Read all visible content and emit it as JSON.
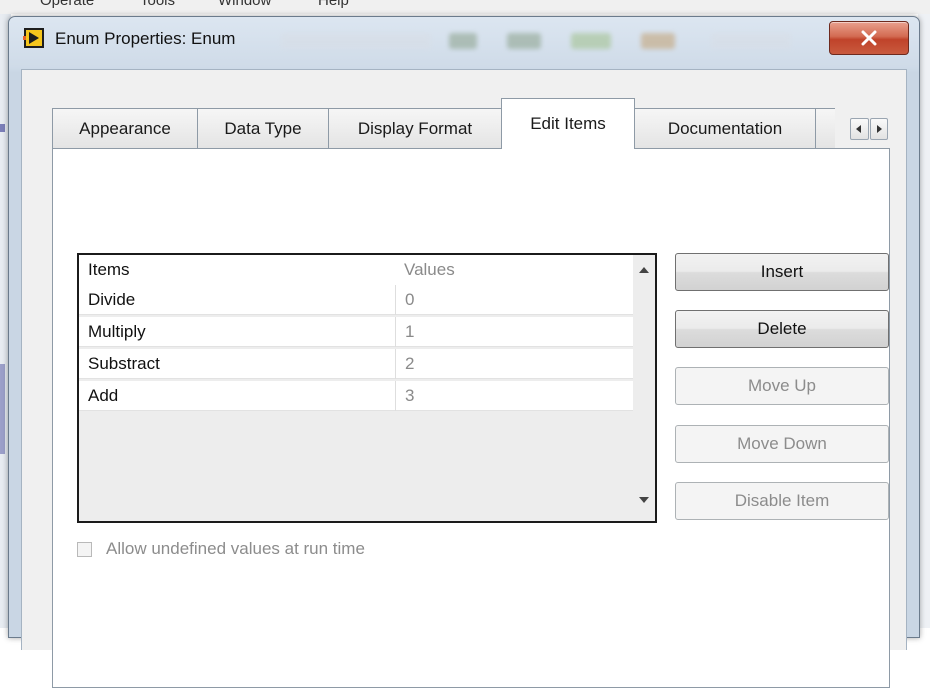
{
  "background_app": {
    "menu_items": [
      "Operate",
      "Tools",
      "Window",
      "Help"
    ]
  },
  "dialog": {
    "title": "Enum Properties: Enum",
    "tabs": [
      {
        "label": "Appearance",
        "active": false
      },
      {
        "label": "Data Type",
        "active": false
      },
      {
        "label": "Display Format",
        "active": false
      },
      {
        "label": "Edit Items",
        "active": true
      },
      {
        "label": "Documentation",
        "active": false
      }
    ],
    "items_table": {
      "columns": [
        "Items",
        "Values"
      ],
      "rows": [
        {
          "item": "Divide",
          "value": "0"
        },
        {
          "item": "Multiply",
          "value": "1"
        },
        {
          "item": "Substract",
          "value": "2"
        },
        {
          "item": "Add",
          "value": "3"
        }
      ]
    },
    "buttons": {
      "insert": {
        "label": "Insert",
        "enabled": true
      },
      "delete": {
        "label": "Delete",
        "enabled": true
      },
      "move_up": {
        "label": "Move Up",
        "enabled": false
      },
      "move_down": {
        "label": "Move Down",
        "enabled": false
      },
      "disable_item": {
        "label": "Disable Item",
        "enabled": false
      }
    },
    "allow_undefined": {
      "label": "Allow undefined values at run time",
      "checked": false,
      "enabled": false
    }
  },
  "colors": {
    "close_button": "#c8472c",
    "disabled_text": "#8c8c8c",
    "value_text": "#8a8a8a"
  }
}
